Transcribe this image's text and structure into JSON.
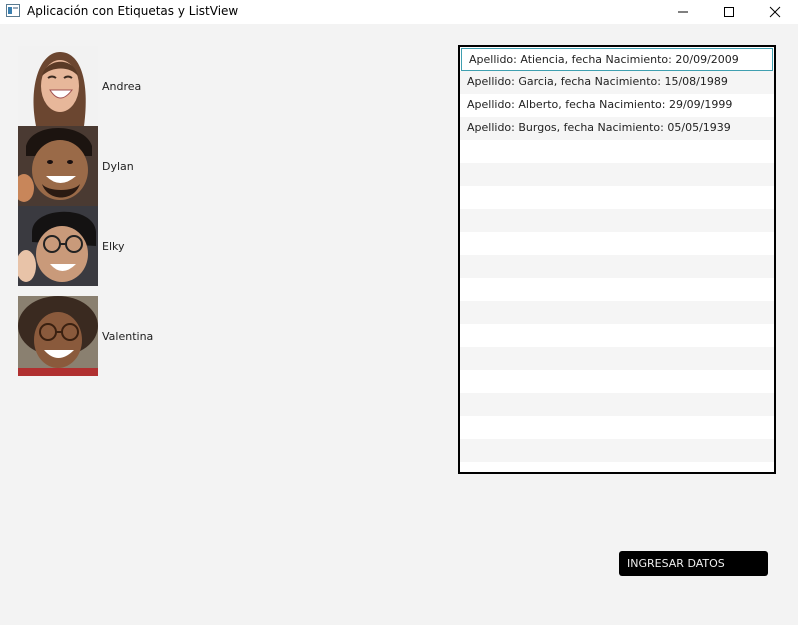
{
  "window": {
    "title": "Aplicación con Etiquetas y ListView",
    "controls": [
      "minimize-icon",
      "maximize-icon",
      "close-icon"
    ]
  },
  "people": [
    {
      "name": "Andrea"
    },
    {
      "name": "Dylan"
    },
    {
      "name": "Elky"
    },
    {
      "name": "Valentina"
    }
  ],
  "listview": {
    "items": [
      "Apellido: Atiencia, fecha Nacimiento: 20/09/2009",
      "Apellido: Garcia, fecha Nacimiento: 15/08/1989",
      "Apellido: Alberto, fecha Nacimiento: 29/09/1999",
      "Apellido: Burgos, fecha Nacimiento: 05/05/1939"
    ],
    "selected_index": 0
  },
  "actions": {
    "ingresar_label": "INGRESAR DATOS"
  },
  "colors": {
    "button_bg": "#000000",
    "selection_border": "#3f9fb0",
    "window_bg": "#f3f3f3"
  }
}
